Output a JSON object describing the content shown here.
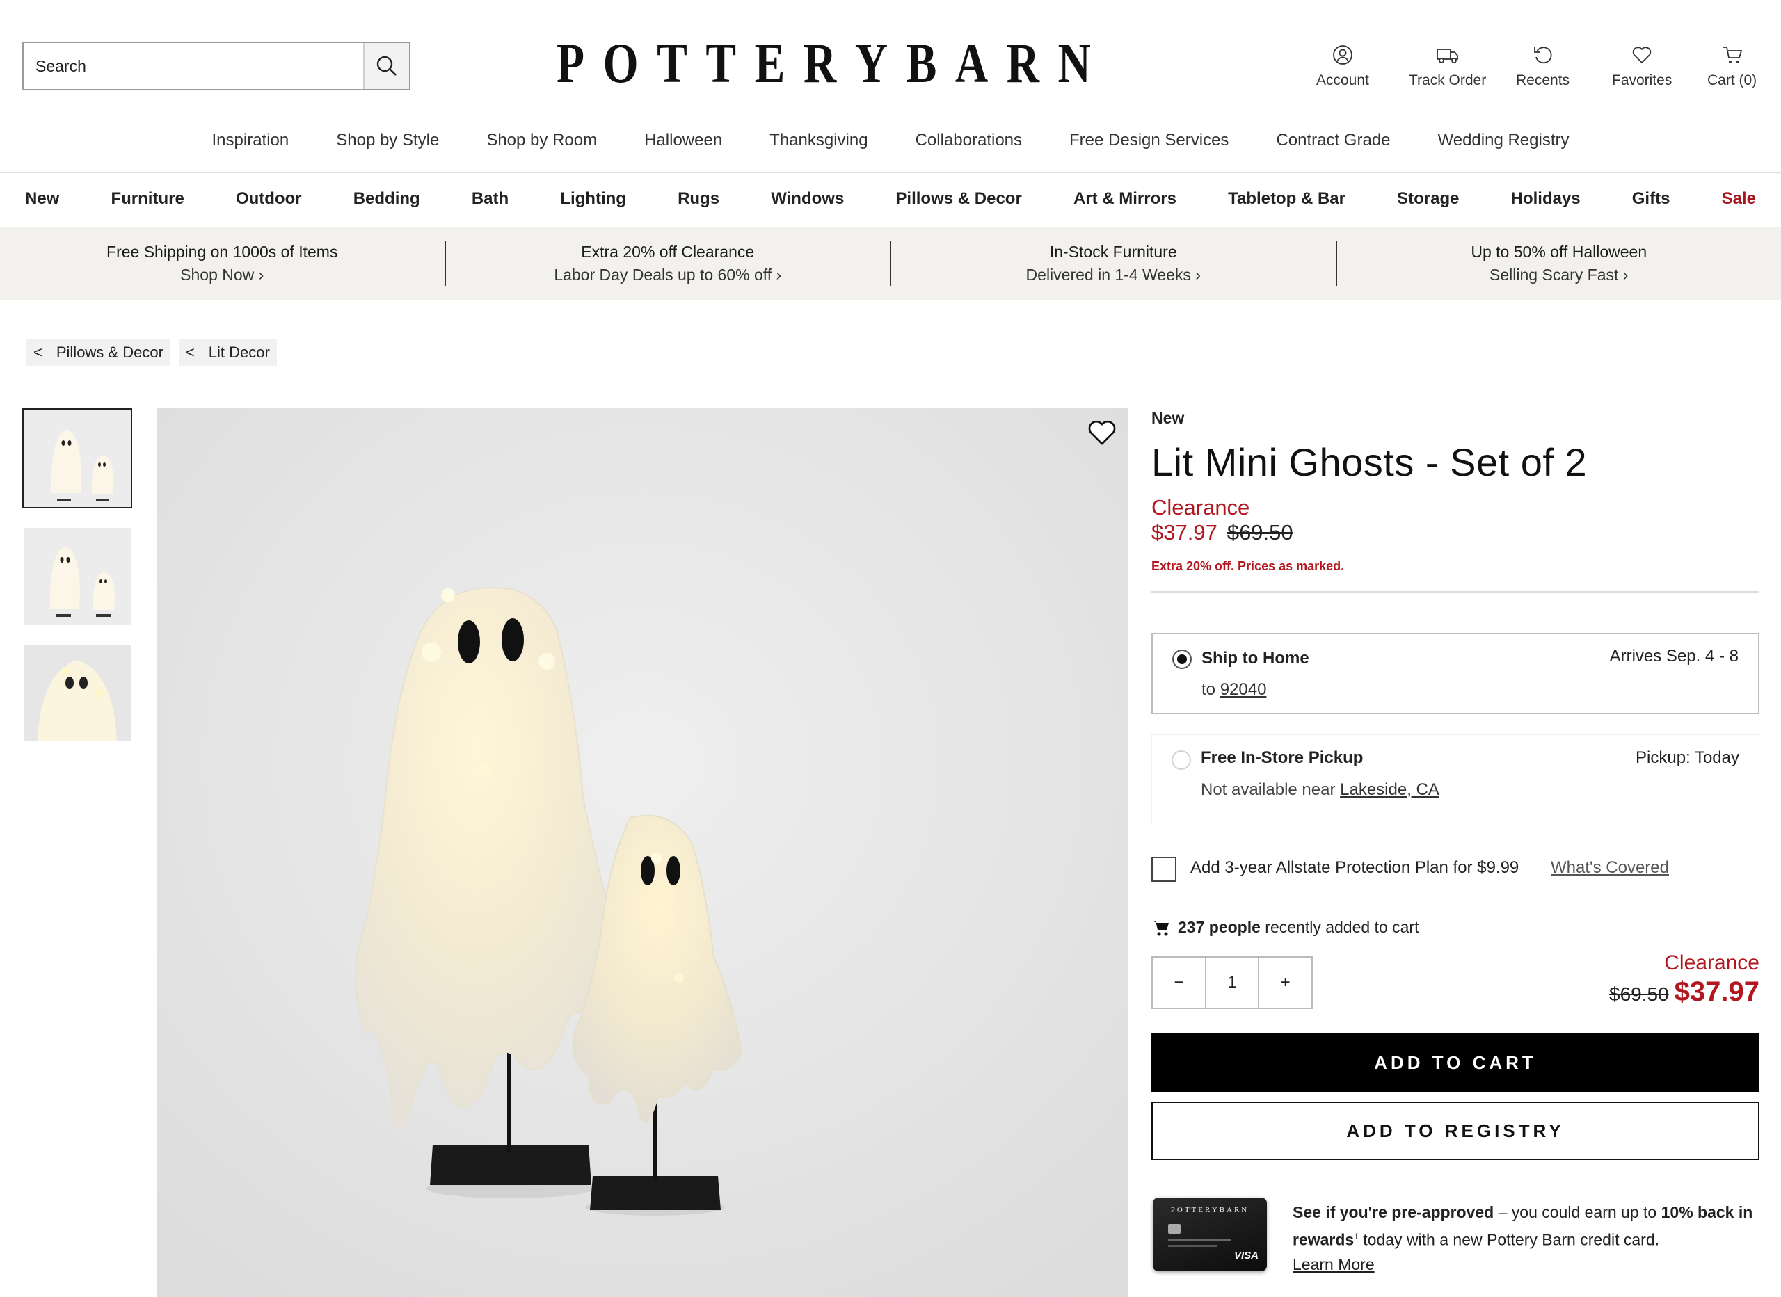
{
  "header": {
    "search_placeholder": "Search",
    "logo_letters": [
      "P",
      "O",
      "T",
      "T",
      "E",
      "R",
      "Y",
      "B",
      "A",
      "R",
      "N"
    ],
    "utility": {
      "account": "Account",
      "track_order": "Track Order",
      "recents": "Recents",
      "favorites": "Favorites",
      "cart": "Cart (0)"
    }
  },
  "primary_nav": [
    "Inspiration",
    "Shop by Style",
    "Shop by Room",
    "Halloween",
    "Thanksgiving",
    "Collaborations",
    "Free Design Services",
    "Contract Grade",
    "Wedding Registry"
  ],
  "category_nav": [
    "New",
    "Furniture",
    "Outdoor",
    "Bedding",
    "Bath",
    "Lighting",
    "Rugs",
    "Windows",
    "Pillows & Decor",
    "Art & Mirrors",
    "Tabletop & Bar",
    "Storage",
    "Holidays",
    "Gifts",
    "Sale"
  ],
  "promos": [
    {
      "title": "Free Shipping on 1000s of Items",
      "sub": "Shop Now ›"
    },
    {
      "title": "Extra 20% off Clearance",
      "sub": "Labor Day Deals up to 60% off ›"
    },
    {
      "title": "In-Stock Furniture",
      "sub": "Delivered in 1-4 Weeks ›"
    },
    {
      "title": "Up to 50% off Halloween",
      "sub": "Selling Scary Fast ›"
    }
  ],
  "breadcrumb": [
    {
      "arrow": "<",
      "label": "Pillows & Decor"
    },
    {
      "arrow": "<",
      "label": "Lit Decor"
    }
  ],
  "product": {
    "badge": "New",
    "name": "Lit Mini Ghosts - Set of 2",
    "clearance_label": "Clearance",
    "sale_price": "$37.97",
    "original_price": "$69.50",
    "extra_note": "Extra 20% off. Prices as marked."
  },
  "fulfillment": {
    "ship": {
      "label": "Ship to Home",
      "to_prefix": "to",
      "zip": "92040",
      "arrives": "Arrives Sep. 4 - 8",
      "selected": true
    },
    "pickup": {
      "label": "Free In-Store Pickup",
      "note": "Not available near",
      "store": "Lakeside, CA",
      "when": "Pickup: Today",
      "selected": false
    }
  },
  "protection": {
    "label": "Add 3-year Allstate Protection Plan for $9.99",
    "link": "What's Covered",
    "checked": false
  },
  "social_proof": {
    "count": "237 people",
    "text": "recently added to cart"
  },
  "quantity": {
    "minus": "−",
    "value": "1",
    "plus": "+"
  },
  "summary_price": {
    "clearance_label": "Clearance",
    "original": "$69.50",
    "sale": "$37.97"
  },
  "buttons": {
    "add_to_cart": "ADD TO CART",
    "add_to_registry": "ADD TO REGISTRY"
  },
  "credit_offer": {
    "bold1": "See if you're pre-approved",
    "text1": " – you could earn up to ",
    "bold2": "10% back in rewards",
    "sup": "1",
    "text2": " today with a new Pottery Barn credit card.",
    "link": "Learn More",
    "card_brand": "POTTERYBARN",
    "card_network": "VISA"
  },
  "colors": {
    "accent_red": "#b2171f",
    "promo_bg": "#f3f1ee",
    "black": "#000000"
  }
}
